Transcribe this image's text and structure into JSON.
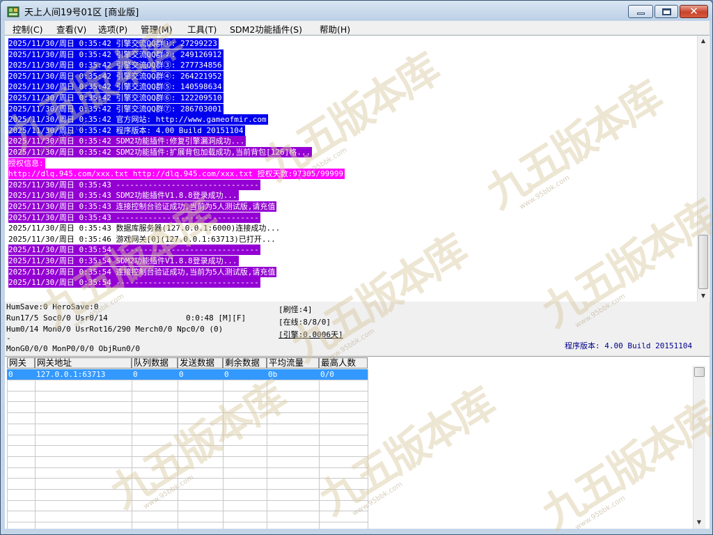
{
  "window": {
    "title": "天上人间19号01区 [商业版]",
    "close_glyph": "✕"
  },
  "menu": [
    {
      "label": "控制(C)"
    },
    {
      "label": "查看(V)"
    },
    {
      "label": "选项(P)"
    },
    {
      "label": "管理(M)"
    },
    {
      "label": "工具(T)"
    },
    {
      "label": "SDM2功能插件(S)"
    },
    {
      "label": "帮助(H)"
    }
  ],
  "colors": {
    "blue_highlight": "#0000ee",
    "purple_highlight": "#9400d3",
    "magenta_highlight": "#ff00ff",
    "selected_row": "#3399ff"
  },
  "log_lines": [
    {
      "text": "2025/11/30/周日 0:35:42 引擎交流QQ群①: 27299223",
      "style": "blue"
    },
    {
      "text": "2025/11/30/周日 0:35:42 引擎交流QQ群②: 249126912",
      "style": "blue"
    },
    {
      "text": "2025/11/30/周日 0:35:42 引擎交流QQ群③: 277734856",
      "style": "blue"
    },
    {
      "text": "2025/11/30/周日 0:35:42 引擎交流QQ群④: 264221952",
      "style": "blue"
    },
    {
      "text": "2025/11/30/周日 0:35:42 引擎交流QQ群⑤: 140598634",
      "style": "blue"
    },
    {
      "text": "2025/11/30/周日 0:35:42 引擎交流QQ群⑥: 122209510",
      "style": "blue"
    },
    {
      "text": "2025/11/30/周日 0:35:42 引擎交流QQ群⑦: 286703001",
      "style": "blue"
    },
    {
      "text": "2025/11/30/周日 0:35:42 官方网站: http://www.gameofmir.com",
      "style": "blue"
    },
    {
      "text": "2025/11/30/周日 0:35:42 程序版本: 4.00 Build 20151104",
      "style": "blue"
    },
    {
      "text": "2025/11/30/周日 0:35:42 SDM2功能插件:修复引擎漏洞成功...",
      "style": "purple"
    },
    {
      "text": "2025/11/30/周日 0:35:42 SDM2功能插件:扩展背包加载成功,当前背包[126]格...",
      "style": "purple"
    },
    {
      "text": "授权信息:",
      "style": "magenta"
    },
    {
      "text": "http://dlq.945.com/xxx.txt http://dlq.945.com/xxx.txt 授权天数:97305/99999",
      "style": "magenta"
    },
    {
      "text": "2025/11/30/周日 0:35:43 -------------------------------",
      "style": "purple"
    },
    {
      "text": "2025/11/30/周日 0:35:43 SDM2功能插件V1.8.8登录成功...",
      "style": "purple"
    },
    {
      "text": "2025/11/30/周日 0:35:43 连接控制台验证成功,当前为5人测试版,请充值",
      "style": "purple"
    },
    {
      "text": "2025/11/30/周日 0:35:43 -------------------------------",
      "style": "purple"
    },
    {
      "text": "2025/11/30/周日 0:35:43 数据库服务器(127.0.0.1:6000)连接成功...",
      "style": "plain"
    },
    {
      "text": "2025/11/30/周日 0:35:46 游戏网关[0](127.0.0.1:63713)已打开...",
      "style": "plain"
    },
    {
      "text": "2025/11/30/周日 0:35:54 -------------------------------",
      "style": "purple"
    },
    {
      "text": "2025/11/30/周日 0:35:54 SDM2功能插件V1.8.8登录成功...",
      "style": "purple"
    },
    {
      "text": "2025/11/30/周日 0:35:54 连接控制台验证成功,当前为5人测试版,请充值",
      "style": "purple"
    },
    {
      "text": "2025/11/30/周日 0:35:54 -------------------------------",
      "style": "purple"
    }
  ],
  "status": {
    "humsave": "HumSave:0 HeroSave:0",
    "run": "Run17/5 Soc0/0 Usr0/14",
    "time": "0:0:48 [M][F]",
    "hum": "Hum0/14 Mon0/0 UsrRot16/290 Merch0/0 Npc0/0 (0)",
    "dash": "-",
    "mong": "MonG0/0/0 MonP0/0/0 ObjRun0/0",
    "refresh": "[刷怪:4]",
    "online": "[在线:8/8/0]",
    "engine": "[引擎:0.0006天]",
    "version": "程序版本: 4.00 Build 20151104"
  },
  "grid": {
    "headers": [
      "网关",
      "网关地址",
      "队列数据",
      "发送数据",
      "剩余数据",
      "平均流量",
      "最高人数"
    ],
    "rows": [
      [
        "0",
        "127.0.0.1:63713",
        "0",
        "0",
        "0",
        "0b",
        "0/0"
      ]
    ]
  },
  "watermark": {
    "text": "九五版本库",
    "url": "www.95bbk.com"
  }
}
